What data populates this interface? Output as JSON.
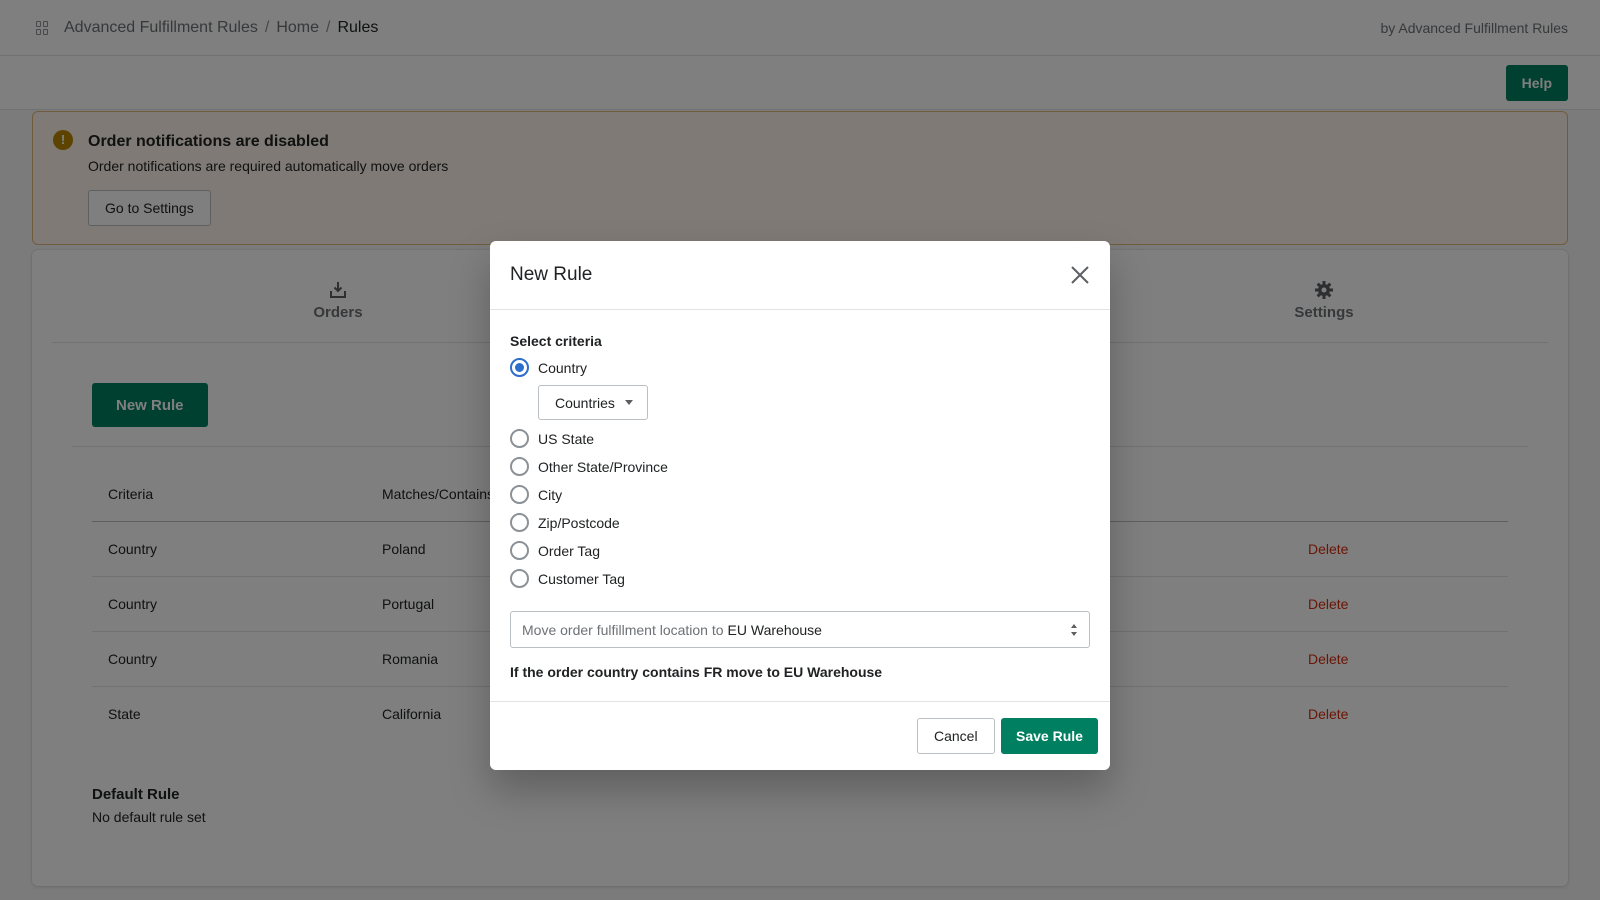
{
  "breadcrumb": {
    "app_name": "Advanced Fulfillment Rules",
    "separator": "/",
    "home": "Home",
    "current": "Rules"
  },
  "byline": "by Advanced Fulfillment Rules",
  "help_label": "Help",
  "banner": {
    "icon": "exclamation-icon",
    "title": "Order notifications are disabled",
    "text": "Order notifications are required automatically move orders",
    "button": "Go to Settings"
  },
  "tabs": [
    {
      "label": "Orders",
      "icon": "download-tray-icon"
    },
    {
      "label": "Settings",
      "icon": "gear-icon"
    }
  ],
  "new_rule_label": "New Rule",
  "table": {
    "headers": [
      "Criteria",
      "Matches/Contains"
    ],
    "rows": [
      {
        "criteria": "Country",
        "match": "Poland",
        "action": "Delete"
      },
      {
        "criteria": "Country",
        "match": "Portugal",
        "action": "Delete"
      },
      {
        "criteria": "Country",
        "match": "Romania",
        "action": "Delete"
      },
      {
        "criteria": "State",
        "match": "California",
        "action": "Delete"
      }
    ]
  },
  "default_rule": {
    "title": "Default Rule",
    "text": "No default rule set"
  },
  "modal": {
    "title": "New Rule",
    "criteria_label": "Select criteria",
    "options": [
      "Country",
      "US State",
      "Other State/Province",
      "City",
      "Zip/Postcode",
      "Order Tag",
      "Customer Tag"
    ],
    "selected_option": "Country",
    "countries_button": "Countries",
    "select_prefix": "Move order fulfillment location to",
    "select_value": "EU Warehouse",
    "summary": "If the order country contains FR move to EU Warehouse",
    "cancel_label": "Cancel",
    "save_label": "Save Rule"
  },
  "colors": {
    "primary": "#008060",
    "danger": "#d72c0d",
    "radio_selected": "#2c6ecb",
    "banner_bg": "#fff5ea",
    "banner_icon": "#b98900"
  }
}
